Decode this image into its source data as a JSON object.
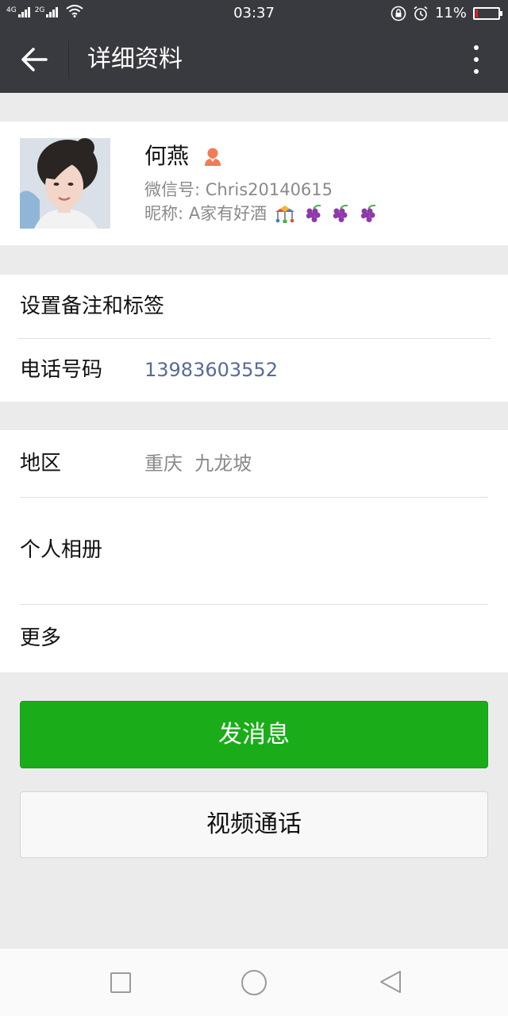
{
  "status_bar": {
    "sim1": "4G",
    "sim2": "2G",
    "time": "03:37",
    "battery_percent": "11%",
    "battery_level": 0.11,
    "icons": [
      "signal-icon",
      "wifi-icon",
      "rotation-lock-icon",
      "alarm-icon",
      "battery-icon"
    ]
  },
  "app_bar": {
    "title": "详细资料",
    "icons": [
      "back-arrow-icon",
      "more-vertical-icon"
    ]
  },
  "profile": {
    "name": "何燕",
    "wechat_id": "微信号: Chris20140615",
    "nickname": "昵称: A家有好酒",
    "icons": [
      "female-person-icon",
      "carousel-emoji-icon",
      "grapes-emoji-icon"
    ]
  },
  "info_rows": {
    "remark": {
      "label": "设置备注和标签"
    },
    "phone": {
      "label": "电话号码",
      "value": "13983603552"
    },
    "region": {
      "label": "地区",
      "value": "重庆  九龙坡"
    },
    "album": {
      "label": "个人相册"
    },
    "more": {
      "label": "更多"
    }
  },
  "actions": {
    "send_message": "发消息",
    "video_call": "视频通话"
  },
  "nav_bar": {
    "icons": [
      "recent-apps-icon",
      "home-icon",
      "back-triangle-icon"
    ]
  },
  "colors": {
    "bar_dark": "#393a3f",
    "primary_green": "#1aad19",
    "link_blue": "#576b95",
    "page_bg": "#ebebeb",
    "person_icon": "#f07c58"
  }
}
